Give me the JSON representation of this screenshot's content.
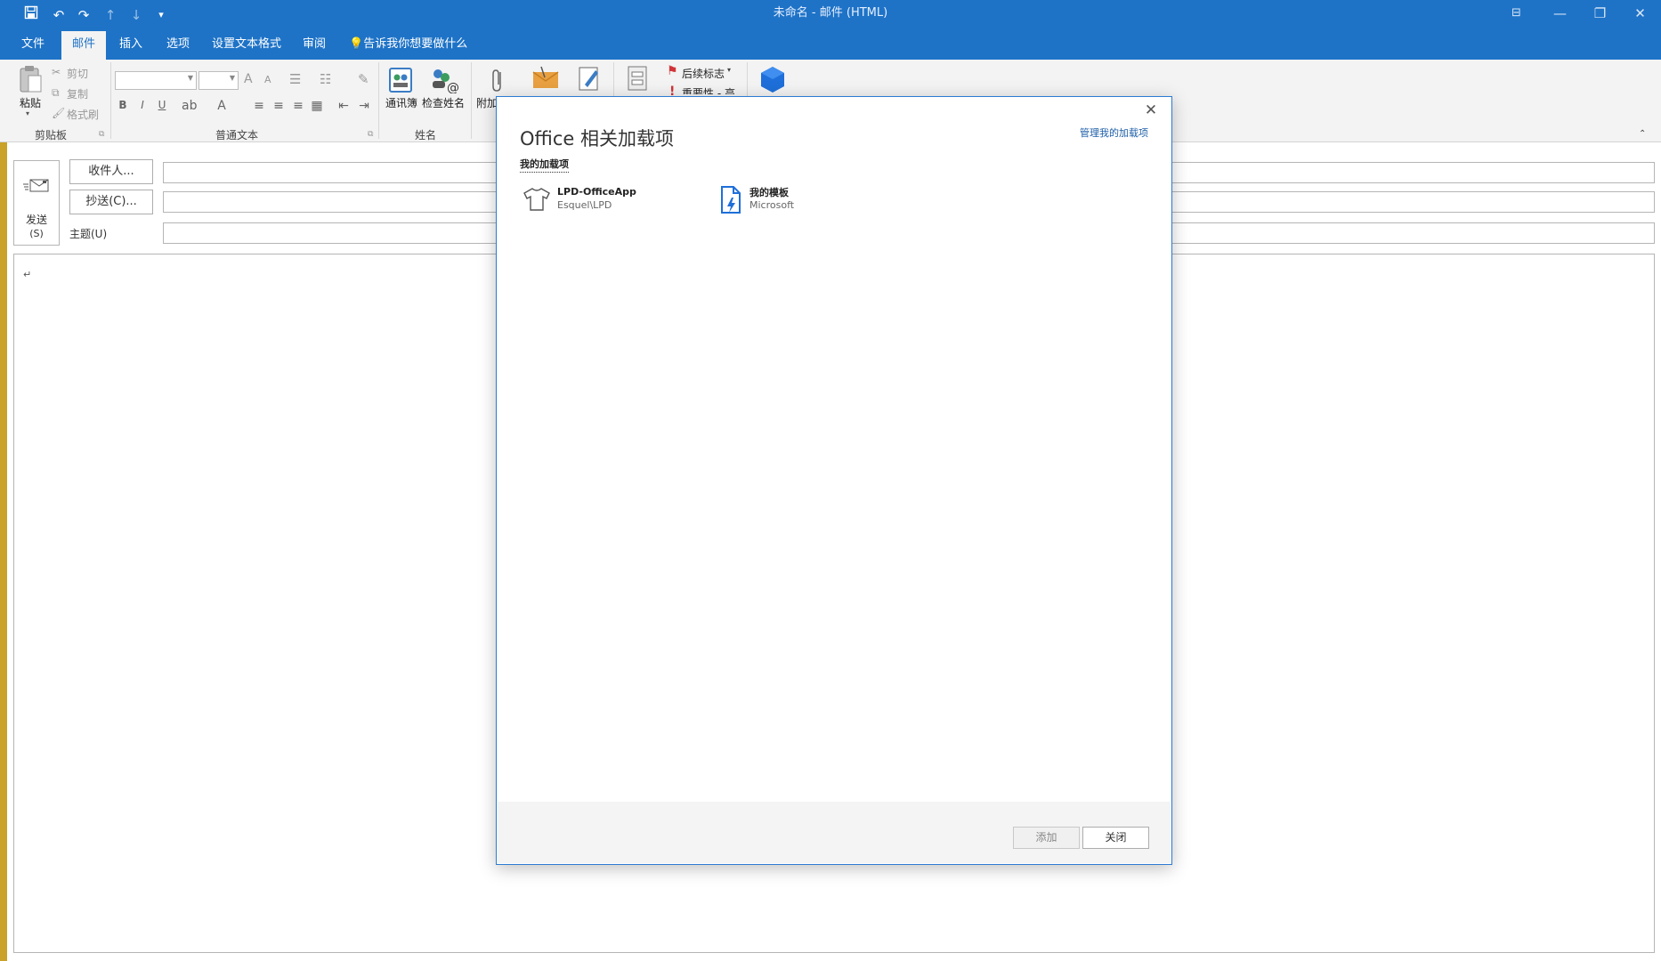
{
  "window": {
    "title": "未命名  -  邮件 (HTML)"
  },
  "tabs": [
    {
      "label": "文件"
    },
    {
      "label": "邮件"
    },
    {
      "label": "插入"
    },
    {
      "label": "选项"
    },
    {
      "label": "设置文本格式"
    },
    {
      "label": "审阅"
    }
  ],
  "tellme": {
    "label": "告诉我你想要做什么"
  },
  "ribbon": {
    "clipboard": {
      "paste": "粘贴",
      "cut": "剪切",
      "copy": "复制",
      "format_painter": "格式刷",
      "group_label": "剪贴板"
    },
    "basic_text": {
      "group_label": "普通文本",
      "bold": "B",
      "italic": "I",
      "underline": "U",
      "grow": "A",
      "shrink": "A"
    },
    "names": {
      "address_book": "通讯簿",
      "check_names": "检查姓名",
      "group_label": "姓名"
    },
    "include": {
      "attach": "附加"
    },
    "tags": {
      "follow_up": "后续标志",
      "importance": "重要性 - 高"
    }
  },
  "compose": {
    "send": "发送",
    "send_key": "(S)",
    "to_button": "收件人...",
    "cc_button": "抄送(C)...",
    "subject_label": "主题(U)",
    "body_mark": "↵"
  },
  "dialog": {
    "title": "Office 相关加载项",
    "manage_link": "管理我的加载项",
    "section_tab": "我的加载项",
    "addins": [
      {
        "name": "LPD-OfficeApp",
        "publisher": "Esquel\\LPD",
        "icon": "tshirt-icon"
      },
      {
        "name": "我的模板",
        "publisher": "Microsoft",
        "icon": "template-document-icon"
      }
    ],
    "add_button": "添加",
    "close_button": "关闭"
  },
  "colors": {
    "accent": "#1e73c7",
    "ribbon_bg": "#f3f3f3",
    "dialog_border": "#2b7cd3",
    "link": "#1e5fa8"
  }
}
